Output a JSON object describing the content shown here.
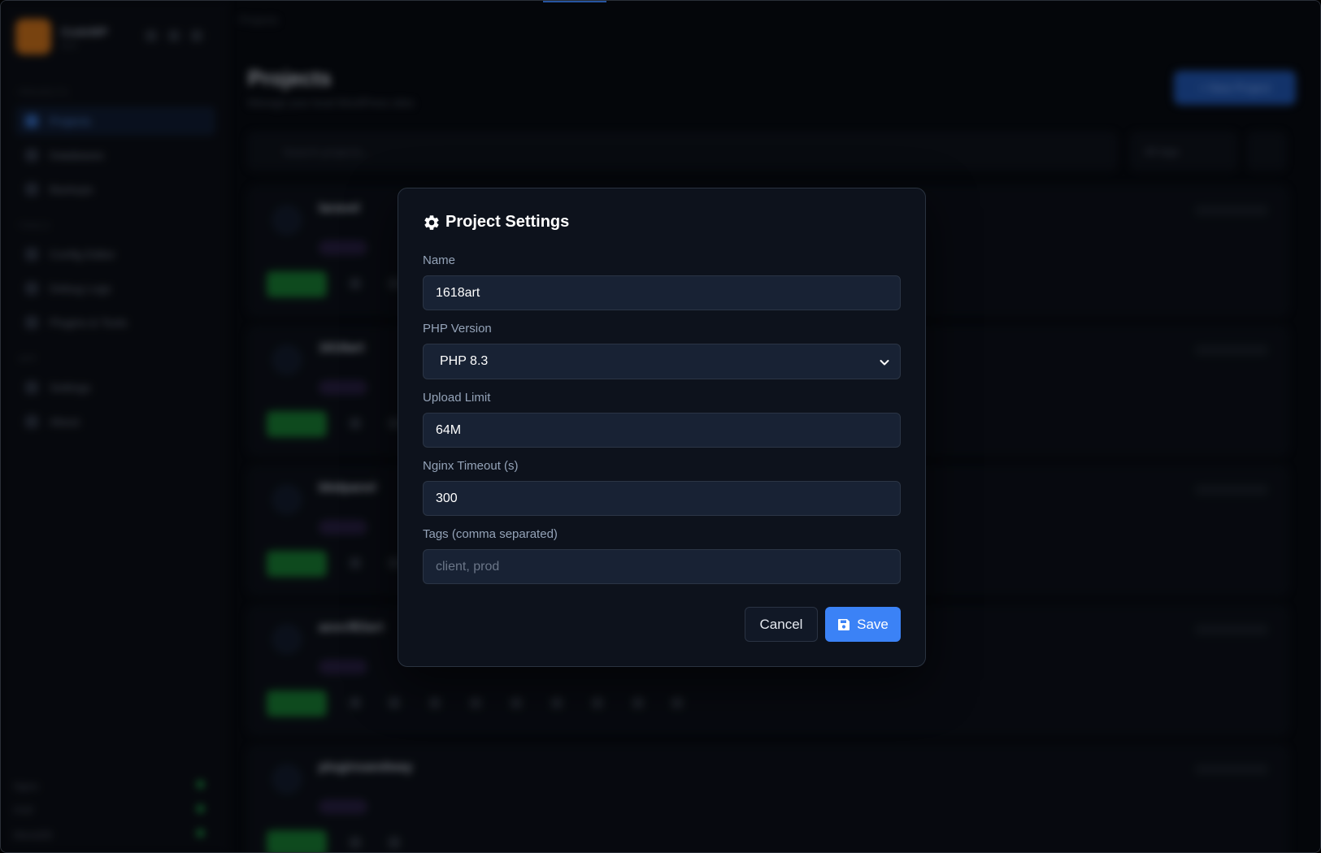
{
  "background": {
    "brand": "CodeWP",
    "brand_sub": "v1.0",
    "sidebar": {
      "section_1": "PROJECTS",
      "items_1": [
        "Projects",
        "Databases",
        "Backups"
      ],
      "section_2": "TOOLS",
      "items_2": [
        "Config Editor",
        "Debug Logs",
        "Plugins & Tools"
      ],
      "section_3": "APP",
      "items_3": [
        "Settings",
        "About"
      ],
      "status": [
        "Nginx",
        "PHP",
        "MariaDB"
      ]
    },
    "breadcrumb": "Projects",
    "page_title": "Projects",
    "page_subtitle": "Manage your local WordPress sites",
    "new_button": "+ New Project",
    "search_placeholder": "Search projects...",
    "filter_label": "All tags",
    "cards": [
      {
        "name": "laravel"
      },
      {
        "name": "1618art"
      },
      {
        "name": "bbdpanel"
      },
      {
        "name": "aovcf83art"
      },
      {
        "name": "pluginsandway"
      }
    ]
  },
  "modal": {
    "title": "Project Settings",
    "fields": {
      "name": {
        "label": "Name",
        "value": "1618art"
      },
      "php_version": {
        "label": "PHP Version",
        "value": "PHP 8.3"
      },
      "upload_limit": {
        "label": "Upload Limit",
        "value": "64M"
      },
      "nginx_timeout": {
        "label": "Nginx Timeout (s)",
        "value": "300"
      },
      "tags": {
        "label": "Tags (comma separated)",
        "value": "",
        "placeholder": "client, prod"
      }
    },
    "cancel_label": "Cancel",
    "save_label": "Save"
  },
  "colors": {
    "accent": "#3b82f6",
    "modal_bg": "#0d121c",
    "field_bg": "#182234",
    "label": "#94a3b8"
  },
  "icons": {
    "title_icon": "gear-icon",
    "select_icon": "chevron-down-icon",
    "save_icon": "floppy-disk-icon"
  }
}
